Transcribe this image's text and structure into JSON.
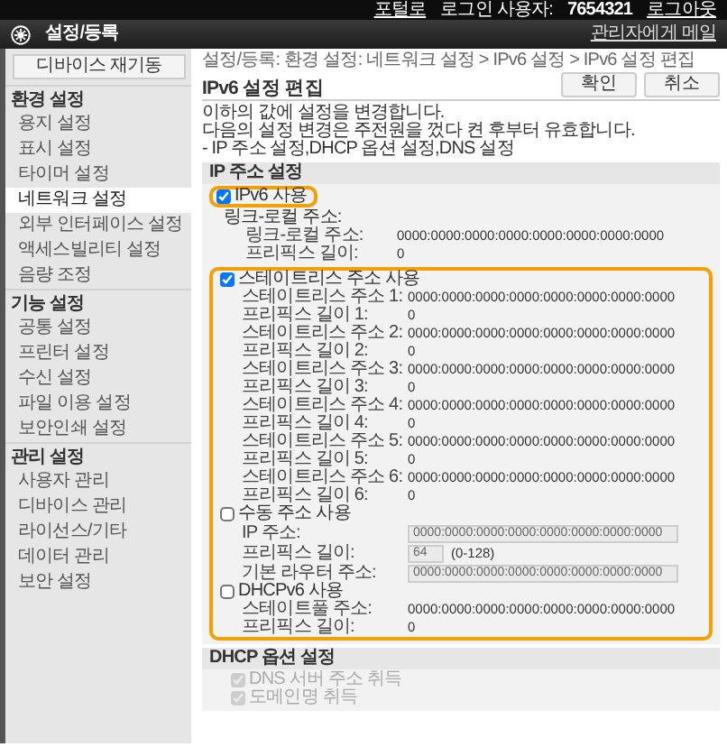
{
  "top_bar": {
    "items": [
      {
        "text": "포털로",
        "kind": "link"
      },
      {
        "text": "로그인 사용자:",
        "kind": "label"
      },
      {
        "text": "7654321",
        "kind": "value"
      },
      {
        "text": "로그아웃",
        "kind": "link"
      }
    ]
  },
  "header": {
    "title": "설정/등록",
    "mail_link": "관리자에게 메일"
  },
  "sidebar": {
    "restart_button": "디바이스 재기동",
    "sections": [
      {
        "heading": "환경 설정",
        "items": [
          {
            "label": "용지 설정",
            "selected": false
          },
          {
            "label": "표시 설정",
            "selected": false
          },
          {
            "label": "타이머 설정",
            "selected": false
          },
          {
            "label": "네트워크 설정",
            "selected": true
          },
          {
            "label": "외부 인터페이스 설정",
            "selected": false
          },
          {
            "label": "액세스빌리티 설정",
            "selected": false
          },
          {
            "label": "음량 조정",
            "selected": false
          }
        ]
      },
      {
        "heading": "기능 설정",
        "items": [
          {
            "label": "공통 설정",
            "selected": false
          },
          {
            "label": "프린터 설정",
            "selected": false
          },
          {
            "label": "수신 설정",
            "selected": false
          },
          {
            "label": "파일 이용 설정",
            "selected": false
          },
          {
            "label": "보안인쇄 설정",
            "selected": false
          }
        ]
      },
      {
        "heading": "관리 설정",
        "items": [
          {
            "label": "사용자 관리",
            "selected": false
          },
          {
            "label": "디바이스 관리",
            "selected": false
          },
          {
            "label": "라이선스/기타",
            "selected": false
          },
          {
            "label": "데이터 관리",
            "selected": false
          },
          {
            "label": "보안 설정",
            "selected": false
          }
        ]
      }
    ]
  },
  "breadcrumb": "설정/등록: 환경 설정: 네트워크 설정 > IPv6 설정 > IPv6 설정 편집",
  "page_title": "IPv6 설정 편집",
  "buttons": [
    "확인",
    "취소"
  ],
  "description": [
    "이하의 값에 설정을 변경합니다.",
    "다음의 설정 변경은 주전원을 껐다 켠 후부터 유효합니다.",
    "- IP 주소 설정,DHCP 옵션 설정,DNS 설정"
  ],
  "ip_section": {
    "heading": "IP 주소 설정",
    "use_ipv6": {
      "label": "IPv6 사용",
      "checked": true,
      "highlighted": true
    },
    "link_local": {
      "heading": "링크-로컬 주소:",
      "rows": [
        {
          "kind": "text",
          "label": "링크-로컬 주소:",
          "value": "0000:0000:0000:0000:0000:0000:0000:0000"
        },
        {
          "kind": "text",
          "label": "프리픽스 길이:",
          "value": "0"
        }
      ]
    },
    "groups_highlighted": true,
    "groups": [
      {
        "label": "스테이트리스 주소 사용",
        "checked": true,
        "rows": [
          {
            "kind": "text",
            "label": "스테이트리스 주소 1:",
            "value": "0000:0000:0000:0000:0000:0000:0000:0000"
          },
          {
            "kind": "text",
            "label": "프리픽스 길이 1:",
            "value": "0"
          },
          {
            "kind": "text",
            "label": "스테이트리스 주소 2:",
            "value": "0000:0000:0000:0000:0000:0000:0000:0000"
          },
          {
            "kind": "text",
            "label": "프리픽스 길이 2:",
            "value": "0"
          },
          {
            "kind": "text",
            "label": "스테이트리스 주소 3:",
            "value": "0000:0000:0000:0000:0000:0000:0000:0000"
          },
          {
            "kind": "text",
            "label": "프리픽스 길이 3:",
            "value": "0"
          },
          {
            "kind": "text",
            "label": "스테이트리스 주소 4:",
            "value": "0000:0000:0000:0000:0000:0000:0000:0000"
          },
          {
            "kind": "text",
            "label": "프리픽스 길이 4:",
            "value": "0"
          },
          {
            "kind": "text",
            "label": "스테이트리스 주소 5:",
            "value": "0000:0000:0000:0000:0000:0000:0000:0000"
          },
          {
            "kind": "text",
            "label": "프리픽스 길이 5:",
            "value": "0"
          },
          {
            "kind": "text",
            "label": "스테이트리스 주소 6:",
            "value": "0000:0000:0000:0000:0000:0000:0000:0000"
          },
          {
            "kind": "text",
            "label": "프리픽스 길이 6:",
            "value": "0"
          }
        ]
      },
      {
        "label": "수동 주소 사용",
        "checked": false,
        "rows": [
          {
            "kind": "input",
            "label": "IP 주소:",
            "value": "0000:0000:0000:0000:0000:0000:0000:0000",
            "disabled": true
          },
          {
            "kind": "input_range",
            "label": "프리픽스 길이:",
            "value": "64",
            "hint": "(0-128)",
            "disabled": true
          },
          {
            "kind": "input",
            "label": "기본 라우터 주소:",
            "value": "0000:0000:0000:0000:0000:0000:0000:0000",
            "disabled": true
          }
        ]
      },
      {
        "label": "DHCPv6 사용",
        "checked": false,
        "rows": [
          {
            "kind": "text",
            "label": "스테이트풀 주소:",
            "value": "0000:0000:0000:0000:0000:0000:0000:0000"
          },
          {
            "kind": "text",
            "label": "프리픽스 길이:",
            "value": "0"
          }
        ]
      }
    ]
  },
  "dhcp_section": {
    "heading": "DHCP 옵션 설정",
    "options": [
      {
        "label": "DNS 서버 주소 취득",
        "checked": true,
        "disabled": true
      },
      {
        "label": "도메인명 취득",
        "checked": true,
        "disabled": true
      }
    ]
  }
}
